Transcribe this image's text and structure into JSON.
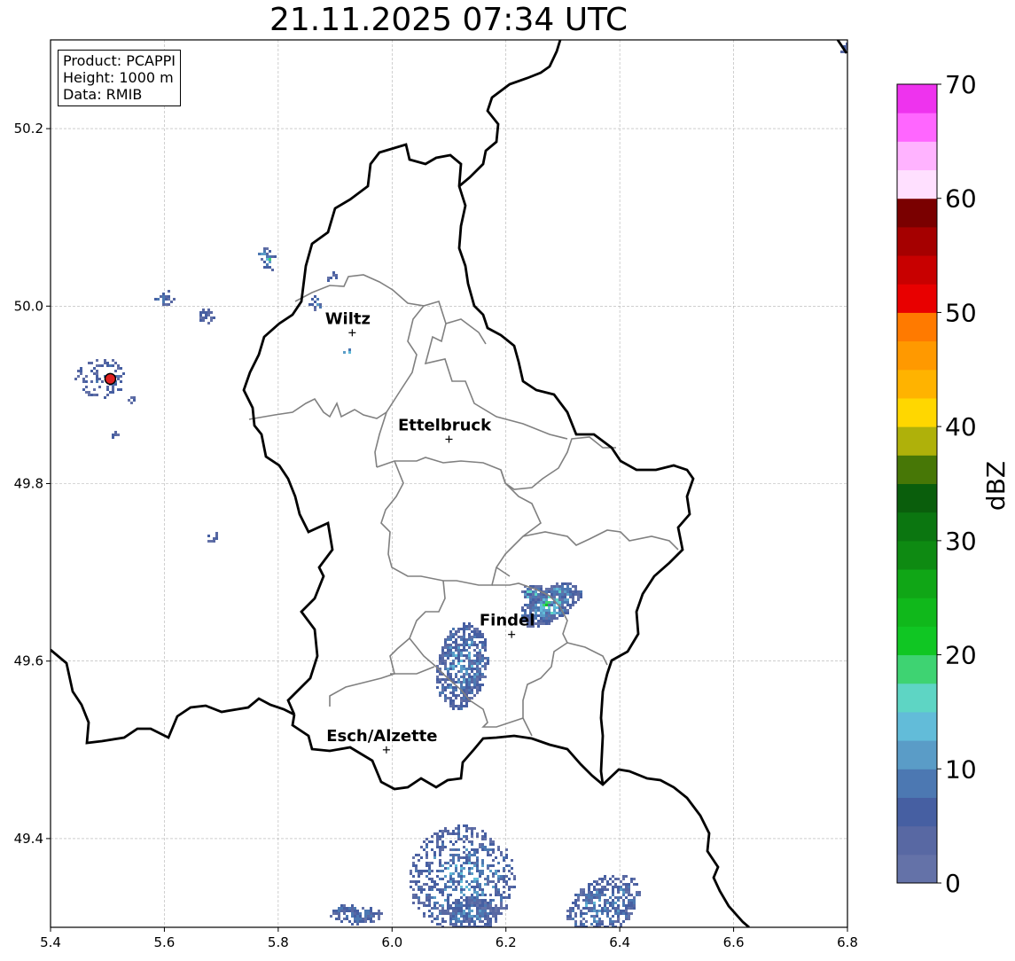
{
  "title": "21.11.2025 07:34 UTC",
  "info": {
    "product": "Product: PCAPPI",
    "height": "Height: 1000 m",
    "data": "Data: RMIB"
  },
  "axes": {
    "x_ticks": [
      "5.4",
      "5.6",
      "5.8",
      "6.0",
      "6.2",
      "6.4",
      "6.6",
      "6.8"
    ],
    "y_ticks": [
      "49.4",
      "49.6",
      "49.8",
      "50.0",
      "50.2"
    ],
    "x_range": [
      5.4,
      6.8
    ],
    "y_range": [
      49.3,
      50.3
    ]
  },
  "cities": [
    {
      "name": "Wiltz",
      "lon": 5.93,
      "lat": 49.97
    },
    {
      "name": "Ettelbruck",
      "lon": 6.1,
      "lat": 49.85
    },
    {
      "name": "Findel",
      "lon": 6.21,
      "lat": 49.63
    },
    {
      "name": "Esch/Alzette",
      "lon": 5.99,
      "lat": 49.5
    }
  ],
  "radar_site": {
    "lon": 5.505,
    "lat": 49.918,
    "color": "#e02020"
  },
  "colorbar": {
    "label": "dBZ",
    "ticks": [
      "0",
      "10",
      "20",
      "30",
      "40",
      "50",
      "60",
      "70"
    ],
    "range": [
      0,
      70
    ],
    "colors": [
      "#6472a8",
      "#5868a3",
      "#465fa2",
      "#4c78b2",
      "#5a9cc7",
      "#62bcd9",
      "#5ed5c4",
      "#3ed372",
      "#10c623",
      "#10b81b",
      "#10a616",
      "#0e8a12",
      "#0b7610",
      "#0a5e0c",
      "#477706",
      "#afb10a",
      "#ffd700",
      "#ffb300",
      "#ff9900",
      "#ff7a00",
      "#e80000",
      "#c80000",
      "#a50000",
      "#7a0000",
      "#ffe0ff",
      "#ffb3ff",
      "#ff66ff",
      "#ee33ee"
    ]
  }
}
